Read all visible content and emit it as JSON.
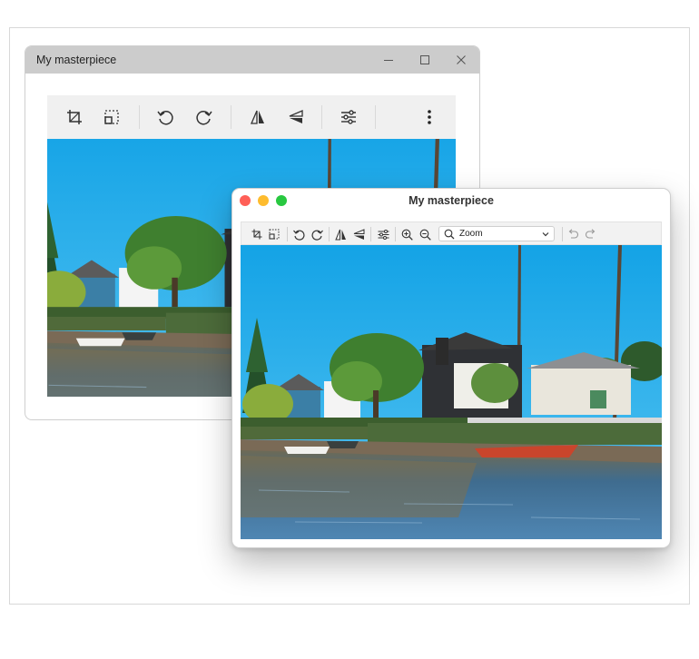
{
  "back_window": {
    "title": "My masterpiece",
    "controls": [
      "minimize-icon",
      "maximize-icon",
      "close-icon"
    ],
    "toolbar": [
      "crop-icon",
      "resize-icon",
      "rotate-left-icon",
      "rotate-right-icon",
      "flip-horizontal-icon",
      "flip-vertical-icon",
      "adjust-icon",
      "more-icon"
    ],
    "image_alt": "Canal with houses and palm trees"
  },
  "front_window": {
    "title": "My masterpiece",
    "traffic_light_colors": [
      "#ff5f57",
      "#febc2e",
      "#28c840"
    ],
    "toolbar": [
      "crop-icon",
      "resize-icon",
      "rotate-left-icon",
      "rotate-right-icon",
      "flip-horizontal-icon",
      "flip-vertical-icon",
      "adjust-icon",
      "zoom-in-icon",
      "zoom-out-icon",
      "undo-icon",
      "redo-icon"
    ],
    "zoom_select": {
      "value": "Zoom"
    },
    "image_alt": "Canal with houses and palm trees"
  }
}
